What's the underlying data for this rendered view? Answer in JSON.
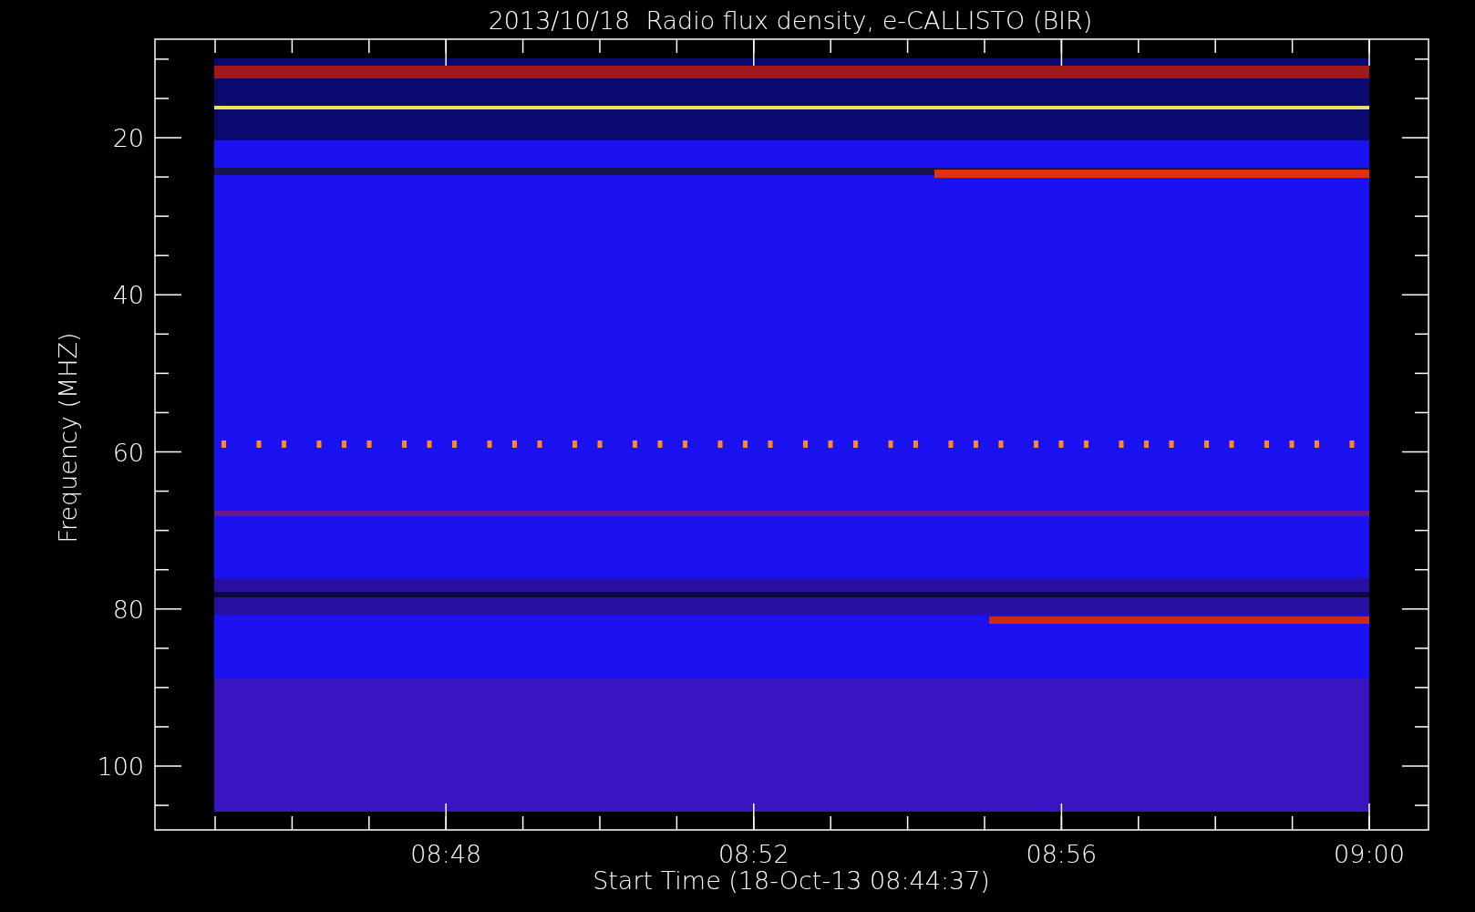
{
  "title": "2013/10/18  Radio flux density, e-CALLISTO (BIR)",
  "ylabel": "Frequency (MHZ)",
  "xlabel": "Start Time (18-Oct-13 08:44:37)",
  "y_ticks": [
    "20",
    "40",
    "60",
    "80",
    "100"
  ],
  "x_ticks": [
    "08:48",
    "08:52",
    "08:56",
    "09:00"
  ],
  "spectrogram": {
    "kind": "picture"
  }
}
